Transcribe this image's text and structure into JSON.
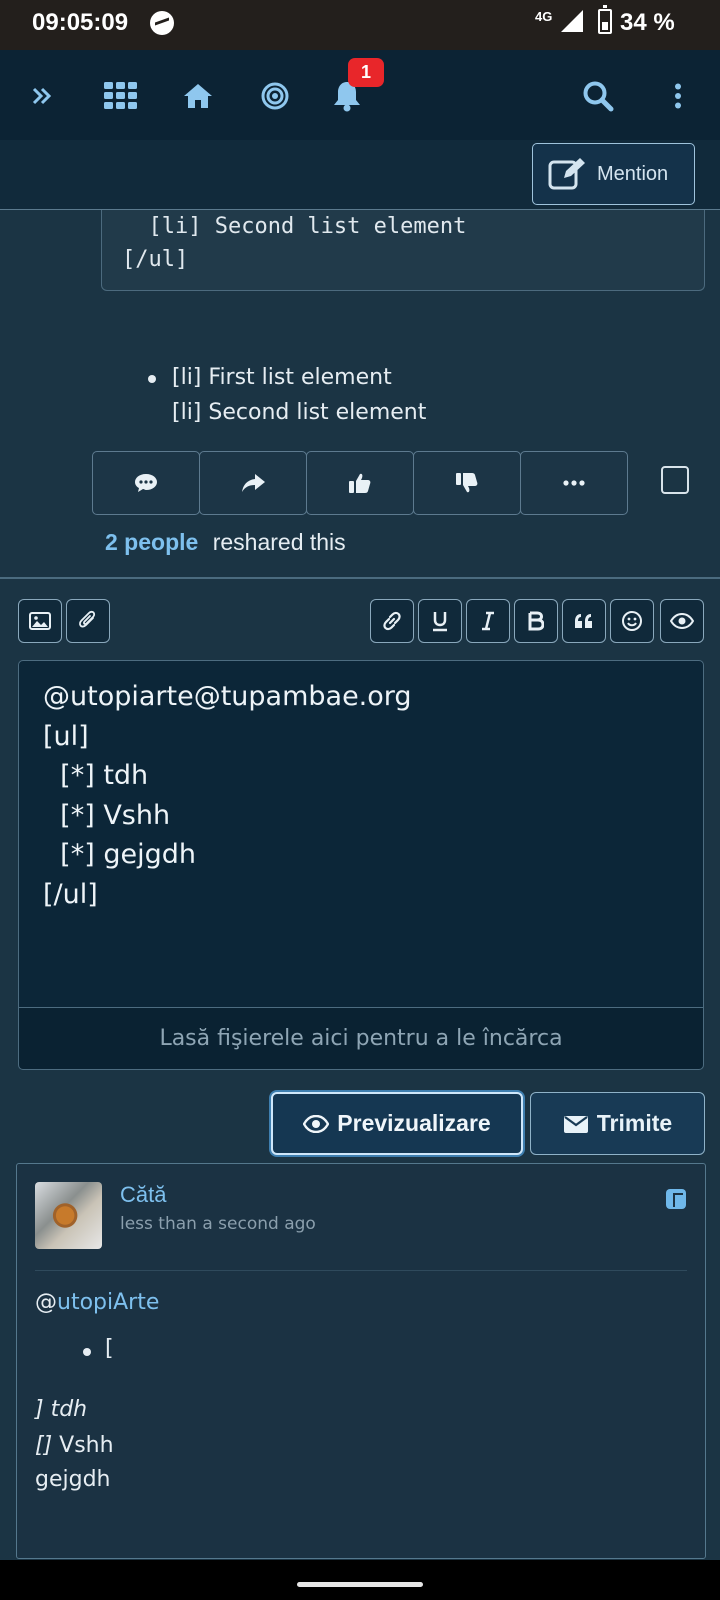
{
  "status": {
    "time": "09:05:09",
    "network": "4G",
    "battery": "34 %"
  },
  "nav": {
    "notification_count": "1"
  },
  "subheader": {
    "mention_label": "Mention"
  },
  "post": {
    "code_lines": "  [li] Second list element\n[/ul]",
    "list_line_1": "[li] First list element",
    "list_line_2": "[li] Second list element",
    "reshare_count": "2 people",
    "reshare_text": "reshared this"
  },
  "editor": {
    "content": "@utopiarte@tupambae.org\n[ul]\n  [*] tdh\n  [*] Vshh\n  [*] gejgdh\n[/ul]",
    "dropzone": "Lasă fişierele aici pentru a le încărca",
    "toolbar_left": [
      "image-icon",
      "paperclip-icon"
    ],
    "toolbar_right": [
      "link-icon",
      "underline-icon",
      "italic-icon",
      "bold-icon",
      "quote-icon",
      "smiley-icon",
      "eye-icon"
    ],
    "preview_label": "Previzualizare",
    "send_label": "Trimite"
  },
  "preview_card": {
    "author": "Cătă",
    "time": "less than a second ago",
    "mention_prefix": "@",
    "mention_name": "utopiArte",
    "bullet_text": "[",
    "line1": "] tdh",
    "line2_a": "[]",
    "line2_b": " Vshh",
    "line3": "gejgdh"
  },
  "colors": {
    "accent": "#7ec0ee",
    "badge": "#e8262a",
    "nav_bg": "#0c2334"
  }
}
